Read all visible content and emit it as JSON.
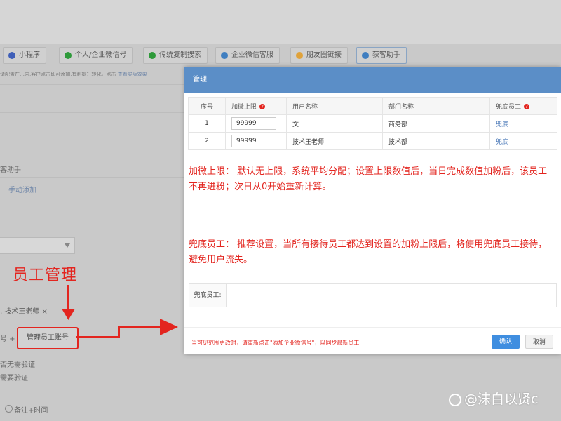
{
  "background": {
    "chips": [
      {
        "label": "小程序",
        "color": "#3f5fb8"
      },
      {
        "label": "个人/企业微信号",
        "color": "#2e9a3a"
      },
      {
        "label": "传统复制搜索",
        "color": "#2e9a3a"
      },
      {
        "label": "企业微信客服",
        "color": "#3f7ec0"
      },
      {
        "label": "朋友圈链接",
        "color": "#e0a23a"
      },
      {
        "label": "获客助手",
        "color": "#3f7ec0"
      }
    ],
    "tip_text": "请配置在…内,客户点击即可添加,有利提升转化。点击",
    "tip_link": "查看实际效果",
    "assistant_label": "客助手",
    "manual_add": "手动添加",
    "tag_text": "技术王老师",
    "tag_close": "×",
    "plus_text": "号 +",
    "manage_button": "管理员工账号",
    "verify_none": "否无需验证",
    "verify_need": "需要验证",
    "radio_label": "备注+时间"
  },
  "annotation": {
    "label": "员工管理",
    "color": "#e3251f"
  },
  "modal": {
    "title": "管理",
    "columns": {
      "seq": "序号",
      "limit": "加微上限",
      "user": "用户名称",
      "dept": "部门名称",
      "backup": "兜底员工"
    },
    "rows": [
      {
        "seq": "1",
        "limit": "99999",
        "user": "文",
        "dept": "商务部",
        "backup": "兜底"
      },
      {
        "seq": "2",
        "limit": "99999",
        "user": "技术王老师",
        "dept": "技术部",
        "backup": "兜底"
      }
    ],
    "note_limit": "加微上限：  默认无上限，系统平均分配；设置上限数值后，当日完成数值加粉后，该员工不再进粉；次日从0开始重新计算。",
    "note_backup": "兜底员工：  推荐设置，当所有接待员工都达到设置的加粉上限后，将使用兜底员工接待，避免用户流失。",
    "backup_field_label": "兜底员工:",
    "footer_tip": "当可见范围更改时，请重新点击\"添加企业微信号\"，以同步最新员工",
    "ok_label": "确认",
    "cancel_label": "取消"
  },
  "watermark": "@沫白以贤c"
}
